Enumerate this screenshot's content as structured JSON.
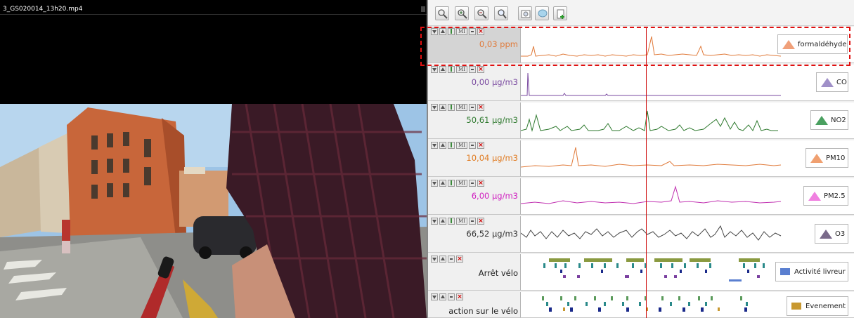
{
  "video": {
    "filename": "3_GS020014_13h20.mp4"
  },
  "toolbar": {
    "buttons": [
      {
        "name": "zoom-fit-button",
        "icon": "zoom-fit-icon"
      },
      {
        "name": "zoom-in-button",
        "icon": "zoom-in-icon"
      },
      {
        "name": "zoom-out-button",
        "icon": "zoom-out-icon"
      },
      {
        "name": "zoom-reset-button",
        "icon": "zoom-reset-icon"
      },
      {
        "name": "camera-button",
        "icon": "camera-icon"
      },
      {
        "name": "comment-button",
        "icon": "speech-bubble-icon"
      },
      {
        "name": "add-track-button",
        "icon": "add-document-icon"
      }
    ]
  },
  "tracks": [
    {
      "id": "formaldehyde",
      "value": "0,03 ppm",
      "legend": "formaldéhyde",
      "color": "#e07a3a",
      "mount_color": "#f0a07a"
    },
    {
      "id": "co",
      "value": "0,00 µg/m3",
      "legend": "CO",
      "color": "#7a4aa0",
      "mount_color": "#a090c8"
    },
    {
      "id": "no2",
      "value": "50,61 µg/m3",
      "legend": "NO2",
      "color": "#2f7a2f",
      "mount_color": "#4aa060"
    },
    {
      "id": "pm10",
      "value": "10,04 µg/m3",
      "legend": "PM10",
      "color": "#e07a20",
      "mount_color": "#f0a070"
    },
    {
      "id": "pm25",
      "value": "6,00 µg/m3",
      "legend": "PM2.5",
      "color": "#d020c0",
      "mount_color": "#f080e0"
    },
    {
      "id": "o3",
      "value": "66,52 µg/m3",
      "legend": "O3",
      "color": "#333333",
      "mount_color": "#7a6a8a"
    },
    {
      "id": "arret-velo",
      "label": "Arrêt vélo",
      "legend": "Activité livreur",
      "legend_color": "#5a7fd0"
    },
    {
      "id": "action-velo",
      "label": "action sur le vélo",
      "legend": "Evenement",
      "legend_color": "#c89830"
    }
  ],
  "colors": {
    "cursor": "#d01010",
    "selection": "#e01010",
    "event_green": "#5a9a5a",
    "event_olive": "#8a9a40",
    "event_teal": "#2a8a8a",
    "event_navy": "#1a2a8a",
    "event_purple": "#7a40a0",
    "event_gold": "#c89830",
    "event_blue": "#5a7fd0"
  },
  "control_icons": [
    "collapse-icon",
    "expand-icon",
    "pin-icon",
    "mi-icon",
    "minimize-icon",
    "delete-icon"
  ]
}
